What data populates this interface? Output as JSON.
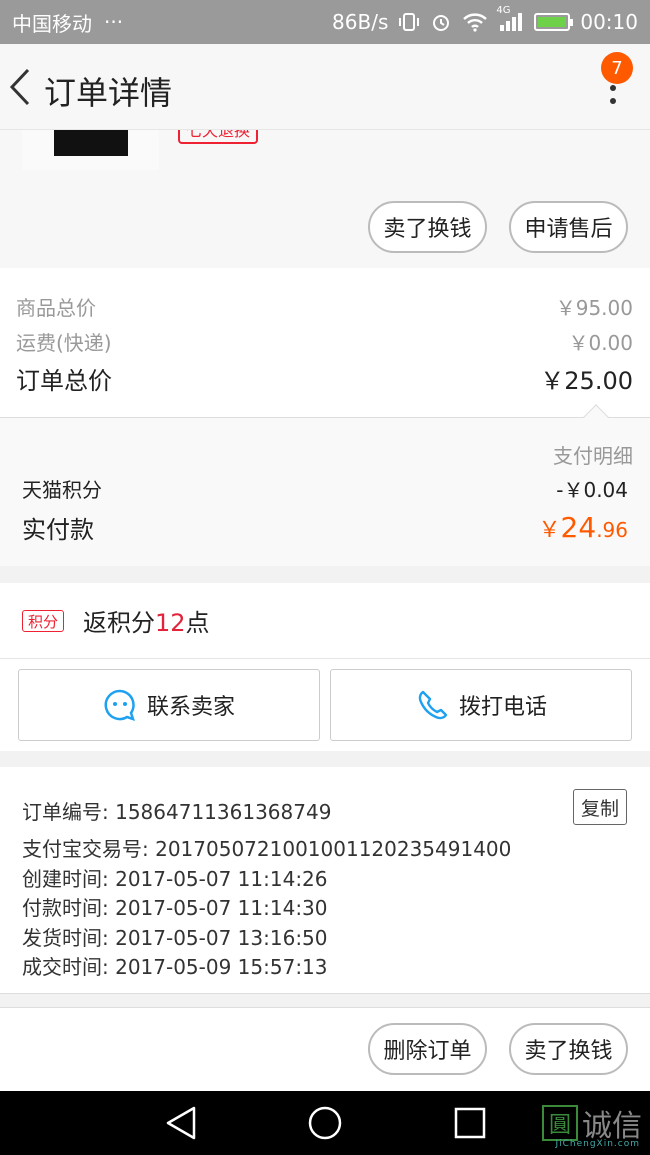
{
  "status_bar": {
    "carrier": "中国移动",
    "dots": "···",
    "speed": "86B/s",
    "network": "4G",
    "time": "00:10"
  },
  "header": {
    "title": "订单详情",
    "badge_count": "7"
  },
  "product": {
    "return_tag": "七天退换",
    "buttons": [
      "卖了换钱",
      "申请售后"
    ]
  },
  "prices": {
    "goods_total_label": "商品总价",
    "goods_total_value": "￥95.00",
    "shipping_label": "运费(快递)",
    "shipping_value": "￥0.00",
    "order_total_label": "订单总价",
    "order_total_value": "￥25.00"
  },
  "payment": {
    "detail_label": "支付明细",
    "points_label": "天猫积分",
    "points_value": "-￥0.04",
    "paid_label": "实付款",
    "paid_currency": "￥",
    "paid_integer": "24",
    "paid_decimal": ".96"
  },
  "points_return": {
    "tag": "积分",
    "prefix": "返积分",
    "count": "12",
    "suffix": "点"
  },
  "contacts": {
    "seller_label": "联系卖家",
    "phone_label": "拨打电话"
  },
  "order_info": {
    "copy_label": "复制",
    "lines": [
      "订单编号: 15864711361368749",
      "支付宝交易号: 2017050721001001120235491400",
      "创建时间: 2017-05-07 11:14:26",
      "付款时间: 2017-05-07 11:14:30",
      "发货时间: 2017-05-07 13:16:50",
      "成交时间: 2017-05-09 15:57:13"
    ]
  },
  "actions": {
    "delete_label": "删除订单",
    "sell_label": "卖了换钱"
  },
  "watermark": {
    "mark": "圓",
    "text": "诚信",
    "sub": "JiChengXin.com"
  },
  "colors": {
    "accent_orange": "#ff5a00",
    "accent_red": "#e2233b",
    "status_bar": "#9a9a9a"
  }
}
